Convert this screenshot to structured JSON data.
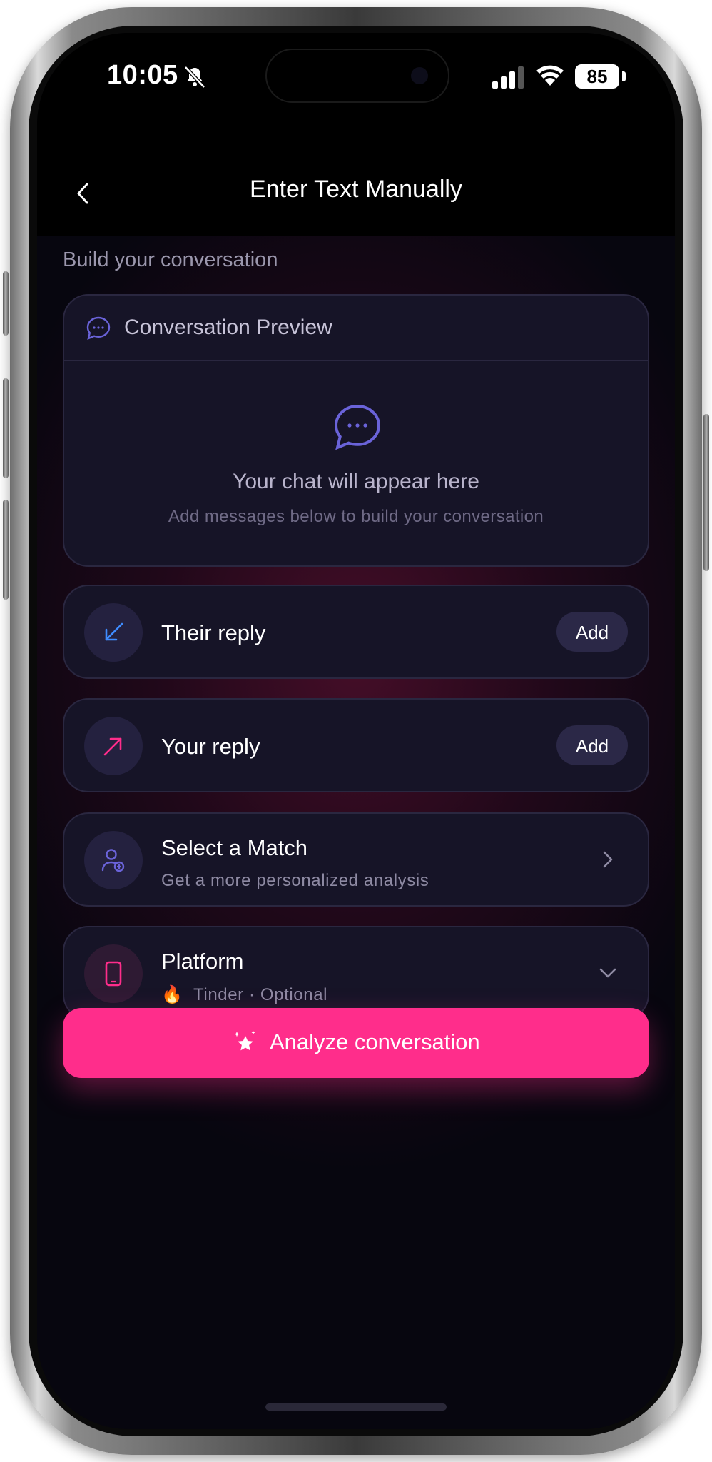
{
  "status_bar": {
    "time": "10:05",
    "battery": "85"
  },
  "header": {
    "title": "Enter Text Manually"
  },
  "section_label": "Build your conversation",
  "preview": {
    "title": "Conversation Preview",
    "empty_title": "Your chat will appear here",
    "empty_subtitle": "Add messages below to build your conversation"
  },
  "their_reply": {
    "label": "Their reply",
    "button": "Add"
  },
  "your_reply": {
    "label": "Your reply",
    "button": "Add"
  },
  "match": {
    "title": "Select a Match",
    "subtitle": "Get a more personalized analysis"
  },
  "platform": {
    "title": "Platform",
    "emoji": "🔥",
    "value": "Tinder · Optional"
  },
  "analyze_button": "Analyze conversation",
  "colors": {
    "accent_pink": "#ff2d8b",
    "accent_blue": "#3f8cff",
    "accent_purple": "#6a63d9",
    "card_bg": "#161427"
  },
  "icons": [
    "chevron-left-icon",
    "bell-slash-icon",
    "signal-icon",
    "wifi-icon",
    "battery-icon",
    "chat-bubble-icon",
    "arrow-down-left-icon",
    "arrow-up-right-icon",
    "user-add-icon",
    "chevron-right-icon",
    "phone-icon",
    "chevron-down-icon",
    "sparkle-star-icon"
  ]
}
